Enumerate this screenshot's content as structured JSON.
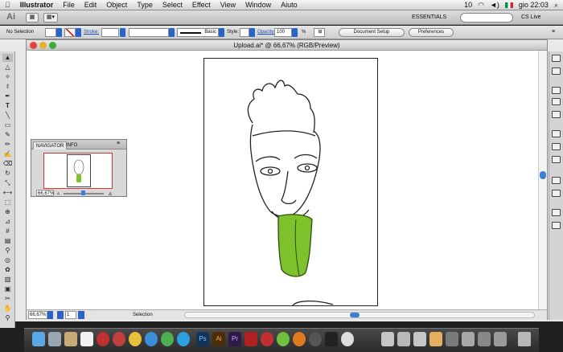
{
  "menubar": {
    "app": "Illustrator",
    "items": [
      "File",
      "Edit",
      "Object",
      "Type",
      "Select",
      "Effect",
      "View",
      "Window",
      "Aiuto"
    ],
    "clock": "gio 22:03",
    "battery": "10"
  },
  "appbar": {
    "logo": "Ai",
    "workspace": "ESSENTIALS",
    "search_placeholder": "",
    "cs_live": "CS Live"
  },
  "control": {
    "selection": "No Selection",
    "stroke_label": "Stroke:",
    "stroke_style": "Basic",
    "style_label": "Style:",
    "opacity_label": "Opacity:",
    "opacity_value": "100",
    "opacity_unit": "%",
    "document_setup": "Document Setup",
    "preferences": "Preferences"
  },
  "document": {
    "title": "Upload.ai* @ 66,67% (RGB/Preview)"
  },
  "navigator": {
    "tabs": [
      "NAVIGATOR",
      "INFO"
    ],
    "zoom": "66,67%"
  },
  "status": {
    "zoom": "66,67%",
    "page": "1",
    "mode": "Selection"
  },
  "colors": {
    "tongue": "#7dc22b",
    "tongue_stroke": "#2d4d10"
  }
}
